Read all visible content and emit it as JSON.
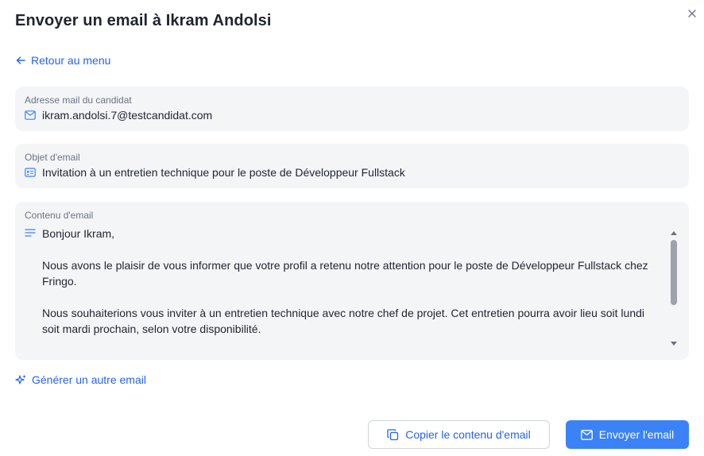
{
  "dialog": {
    "title": "Envoyer un email à Ikram Andolsi"
  },
  "back_link": {
    "label": "Retour au menu"
  },
  "fields": {
    "email": {
      "label": "Adresse mail du candidat",
      "value": "ikram.andolsi.7@testcandidat.com"
    },
    "subject": {
      "label": "Objet d'email",
      "value": "Invitation à un entretien technique pour le poste de Développeur Fullstack"
    },
    "content": {
      "label": "Contenu d'email",
      "paragraphs": [
        "Bonjour Ikram,",
        "Nous avons le plaisir de vous informer que votre profil a retenu notre attention pour le poste de Développeur Fullstack chez Fringo.",
        "Nous souhaiterions vous inviter à un entretien technique avec notre chef de projet. Cet entretien pourra avoir lieu soit lundi soit mardi prochain, selon votre disponibilité."
      ]
    }
  },
  "generate_link": {
    "label": "Générer un autre email"
  },
  "actions": {
    "copy_label": "Copier le contenu d'email",
    "send_label": "Envoyer l'email"
  },
  "icons": {
    "close": "close-icon",
    "back": "arrow-left-icon",
    "email": "envelope-icon",
    "subject": "id-card-icon",
    "content": "text-lines-icon",
    "generate": "sparkles-icon",
    "copy": "copy-icon",
    "send": "send-mail-icon"
  },
  "colors": {
    "accent": "#2563eb",
    "primary_button": "#3b82f6",
    "field_bg": "#f4f5f7"
  }
}
